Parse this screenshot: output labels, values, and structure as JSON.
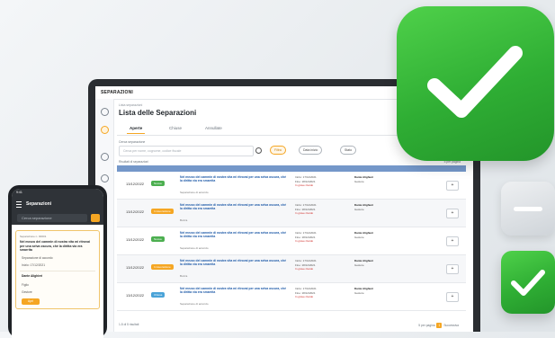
{
  "desktop": {
    "brand": "SEPARAZIONI",
    "breadcrumb": "Lista separazioni",
    "title": "Lista delle Separazioni",
    "tabs": [
      "Aperte",
      "Chiuse",
      "Annullate"
    ],
    "search": {
      "label": "Cerca separazione",
      "placeholder": "Cerca per nome, cognome, codice fiscale"
    },
    "filters": [
      "Filtra",
      "Data inizio",
      "Stato"
    ],
    "results_label": "Risultati di separazioni",
    "rows": [
      {
        "date": "13/12/2022",
        "status": "Nuova",
        "status_color": "#4caf50",
        "title": "Nel mezzo del cammin di nostra vita mi ritrovai per una selva oscura, ché la diritta via era smarrita",
        "subtitle": "Separazione di accordo",
        "start": "Inizio: 17/12/2021",
        "end": "Fine: 18/12/2021",
        "warning": "In grave ritardo",
        "person": "Dante Alighieri",
        "role": "Gestore"
      },
      {
        "date": "13/12/2022",
        "status": "In lavorazione",
        "status_color": "#f5a623",
        "title": "Nel mezzo del cammin di nostra vita mi ritrovai per una selva oscura, ché la diritta via era smarrita",
        "subtitle": "Bozza",
        "start": "Inizio: 17/12/2021",
        "end": "Fine: 18/12/2021",
        "warning": "In grave ritardo",
        "person": "Dante Alighieri",
        "role": "Gestore"
      },
      {
        "date": "13/12/2022",
        "status": "Nuova",
        "status_color": "#4caf50",
        "title": "Nel mezzo del cammin di nostra vita mi ritrovai per una selva oscura, ché la diritta via era smarrita",
        "subtitle": "Separazione di accordo",
        "start": "Inizio: 17/12/2021",
        "end": "Fine: 18/12/2021",
        "warning": "In grave ritardo",
        "person": "Dante Alighieri",
        "role": "Gestore"
      },
      {
        "date": "13/12/2022",
        "status": "In lavorazione",
        "status_color": "#f5a623",
        "title": "Nel mezzo del cammin di nostra vita mi ritrovai per una selva oscura, ché la diritta via era smarrita",
        "subtitle": "Bozza",
        "start": "Inizio: 17/12/2021",
        "end": "Fine: 18/12/2021",
        "warning": "In grave ritardo",
        "person": "Dante Alighieri",
        "role": "Gestore"
      },
      {
        "date": "13/12/2022",
        "status": "Chiusa",
        "status_color": "#4aa3d8",
        "title": "Nel mezzo del cammin di nostra vita mi ritrovai per una selva oscura, ché la diritta via era smarrita",
        "subtitle": "Separazione di accordo",
        "start": "Inizio: 17/12/2021",
        "end": "Fine: 18/12/2021",
        "warning": "In grave ritardo",
        "person": "Dante Alighieri",
        "role": "Gestore"
      }
    ],
    "footer": "1-5 di 5 risultati",
    "pager": {
      "per_page": "5 per pagina",
      "current": "1",
      "next": "Successiva"
    }
  },
  "phone": {
    "time": "9:41",
    "title": "Separazioni",
    "search_placeholder": "Cerca separazione",
    "card": {
      "id": "Separazione n. 00001",
      "title": "Nel mezzo del cammin di nostra vita mi ritrovai per una selva oscura, ché la diritta via era smarrita",
      "line1": "Separazione di accordo",
      "line2": "Inizio: 17/12/2021",
      "person_label": "Dante Alighieri",
      "field2": "Figlio",
      "field3": "Gestore",
      "button": "Apri"
    }
  },
  "colors": {
    "accent": "#f5a623",
    "success": "#2fae34",
    "header_blue": "#7497c9"
  }
}
